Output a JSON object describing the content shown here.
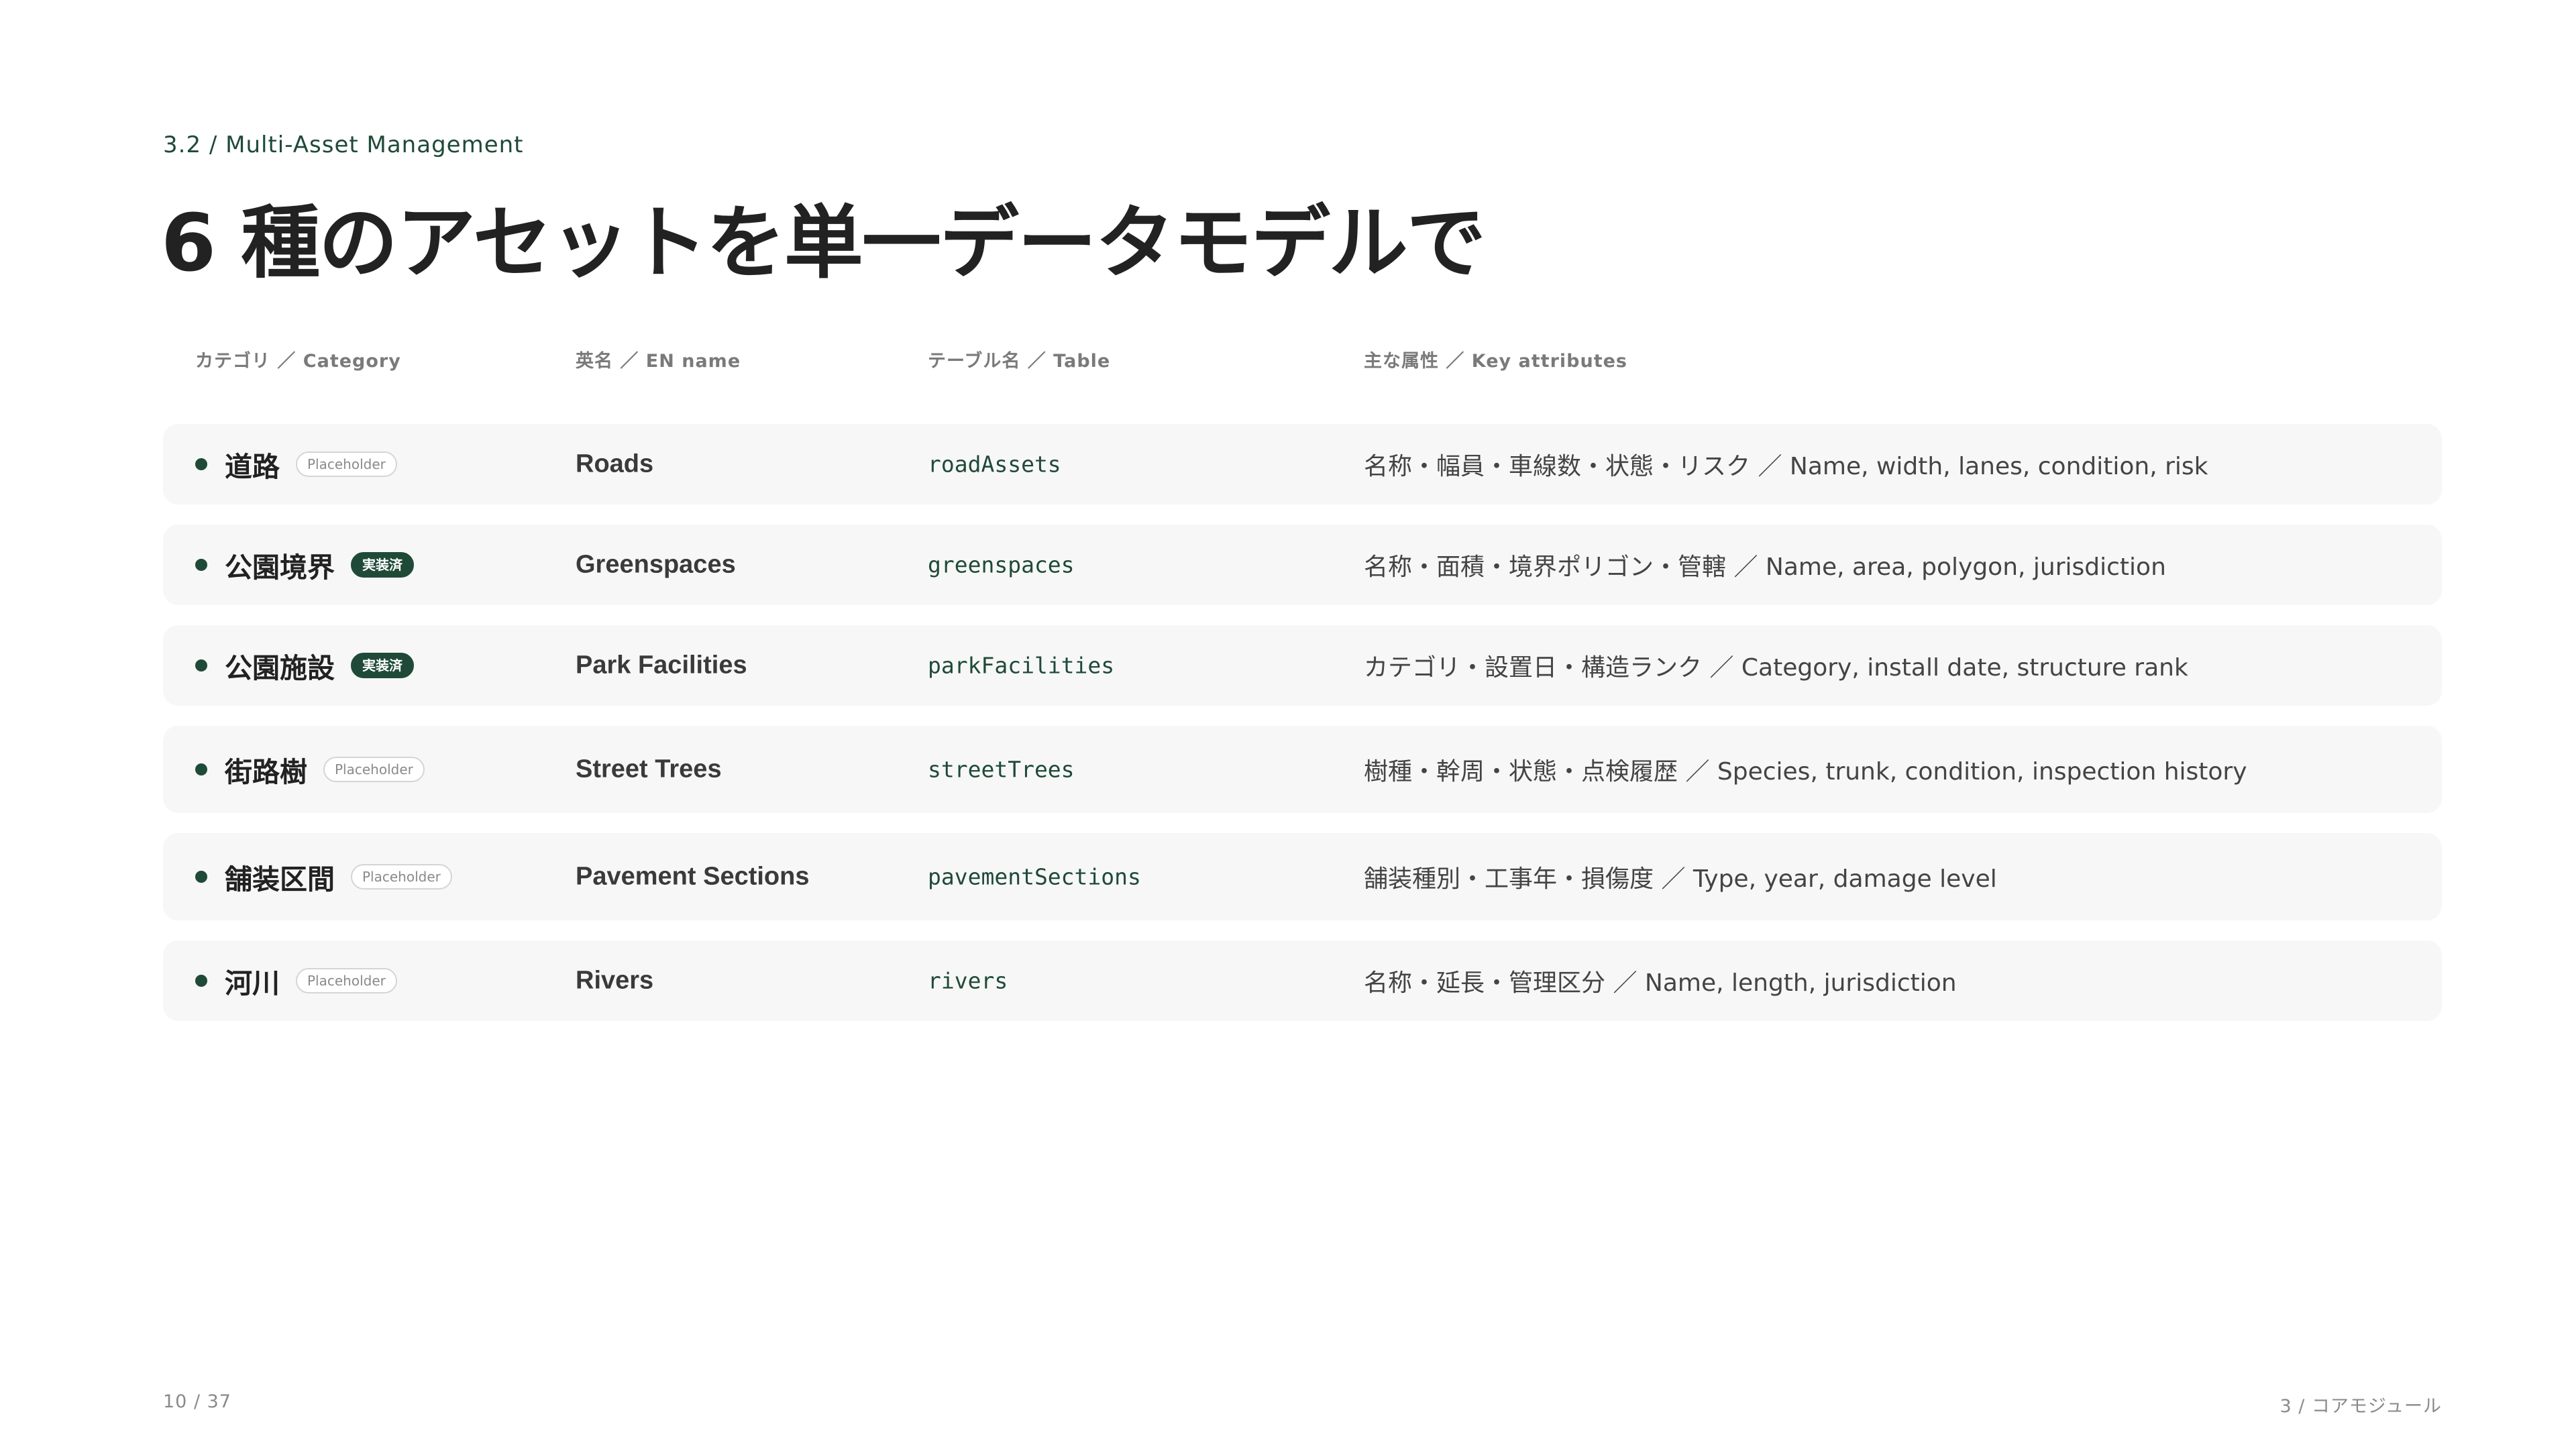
{
  "header": {
    "section_label": "3.2 / Multi-Asset Management",
    "title": "6 種のアセットを単一データモデルで"
  },
  "table": {
    "columns": {
      "category": "カテゴリ ／ Category",
      "en_name": "英名 ／ EN name",
      "table_name": "テーブル名 ／ Table",
      "attributes": "主な属性 ／ Key attributes"
    },
    "rows": [
      {
        "category": "道路",
        "badge": "Placeholder",
        "badge_type": "placeholder",
        "en_name": "Roads",
        "table": "roadAssets",
        "attributes": "名称・幅員・車線数・状態・リスク ／ Name, width, lanes, condition, risk"
      },
      {
        "category": "公園境界",
        "badge": "実装済",
        "badge_type": "done",
        "en_name": "Greenspaces",
        "table": "greenspaces",
        "attributes": "名称・面積・境界ポリゴン・管轄 ／ Name, area, polygon, jurisdiction"
      },
      {
        "category": "公園施設",
        "badge": "実装済",
        "badge_type": "done",
        "en_name": "Park Facilities",
        "table": "parkFacilities",
        "attributes": "カテゴリ・設置日・構造ランク ／ Category, install date, structure rank"
      },
      {
        "category": "街路樹",
        "badge": "Placeholder",
        "badge_type": "placeholder",
        "en_name": "Street Trees",
        "table": "streetTrees",
        "attributes": "樹種・幹周・状態・点検履歴 ／ Species, trunk, condition, inspection history"
      },
      {
        "category": "舗装区間",
        "badge": "Placeholder",
        "badge_type": "placeholder",
        "en_name": "Pavement Sections",
        "table": "pavementSections",
        "attributes": "舗装種別・工事年・損傷度 ／ Type, year, damage level"
      },
      {
        "category": "河川",
        "badge": "Placeholder",
        "badge_type": "placeholder",
        "en_name": "Rivers",
        "table": "rivers",
        "attributes": "名称・延長・管理区分 ／ Name, length, jurisdiction"
      }
    ]
  },
  "footer": {
    "page": "10 / 37",
    "chapter": "3 / コアモジュール"
  },
  "colors": {
    "accent": "#1f4a38",
    "row_background": "#f7f7f7",
    "muted_text": "#8a8a8a"
  }
}
